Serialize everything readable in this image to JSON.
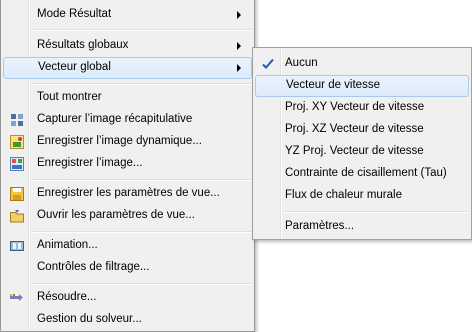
{
  "main_menu": {
    "items": [
      {
        "label": "Mode Résultat"
      },
      {
        "label": "Résultats globaux"
      },
      {
        "label": "Vecteur global"
      },
      {
        "label": "Tout montrer"
      },
      {
        "label": "Capturer l’image récapitulative"
      },
      {
        "label": "Enregistrer l’image dynamique..."
      },
      {
        "label": "Enregistrer l’image..."
      },
      {
        "label": "Enregistrer les paramètres de vue..."
      },
      {
        "label": "Ouvrir les paramètres de vue..."
      },
      {
        "label": "Animation..."
      },
      {
        "label": "Contrôles de filtrage..."
      },
      {
        "label": "Résoudre..."
      },
      {
        "label": "Gestion du solveur..."
      }
    ]
  },
  "submenu": {
    "items": [
      {
        "label": "Aucun",
        "checked": true
      },
      {
        "label": "Vecteur de vitesse"
      },
      {
        "label": "Proj. XY Vecteur de vitesse"
      },
      {
        "label": "Proj. XZ Vecteur de vitesse"
      },
      {
        "label": "YZ Proj. Vecteur de vitesse"
      },
      {
        "label": "Contrainte de cisaillement (Tau)"
      },
      {
        "label": "Flux de chaleur murale"
      },
      {
        "label": "Paramètres..."
      }
    ]
  },
  "colors": {
    "menu_background": "#f0f0f0",
    "highlight": "#dcebfb",
    "highlight_border": "#a8caec",
    "check_color": "#1a5fb4"
  }
}
